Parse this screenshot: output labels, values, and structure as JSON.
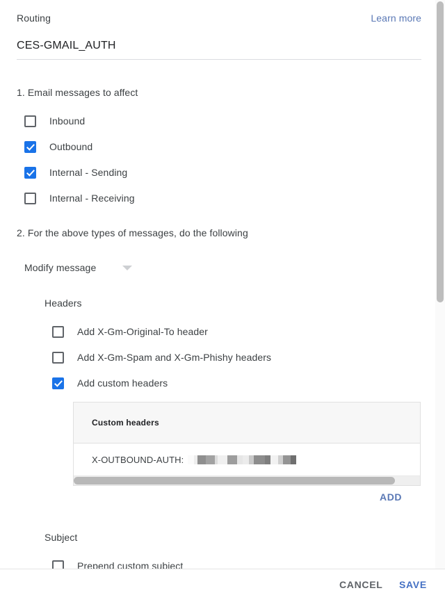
{
  "header": {
    "title": "Routing",
    "learn_more_label": "Learn more"
  },
  "name_field": {
    "value": "CES-GMAIL_AUTH"
  },
  "step1": {
    "heading": "1. Email messages to affect",
    "options": [
      {
        "label": "Inbound",
        "checked": false
      },
      {
        "label": "Outbound",
        "checked": true
      },
      {
        "label": "Internal - Sending",
        "checked": true
      },
      {
        "label": "Internal - Receiving",
        "checked": false
      }
    ]
  },
  "step2": {
    "heading": "2. For the above types of messages, do the following",
    "action_select": {
      "value": "Modify message",
      "arrow_icon": "chevron-down-icon"
    },
    "headers_group": {
      "heading": "Headers",
      "options": [
        {
          "label": "Add X-Gm-Original-To header",
          "checked": false
        },
        {
          "label": "Add X-Gm-Spam and X-Gm-Phishy headers",
          "checked": false
        },
        {
          "label": "Add custom headers",
          "checked": true
        }
      ],
      "custom_headers_table": {
        "column_header": "Custom headers",
        "rows": [
          {
            "key": "X-OUTBOUND-AUTH:",
            "value_redacted": true
          }
        ]
      },
      "add_label": "ADD"
    },
    "subject_group": {
      "heading": "Subject",
      "options": [
        {
          "label": "Prepend custom subject",
          "checked": false
        }
      ]
    }
  },
  "footer": {
    "cancel_label": "CANCEL",
    "save_label": "SAVE"
  },
  "colors": {
    "accent_blue": "#1a73e8",
    "link_blue": "#5a78b5",
    "save_blue": "#4571c4",
    "text_primary": "#3c4043",
    "cancel_gray": "#5f6368"
  }
}
